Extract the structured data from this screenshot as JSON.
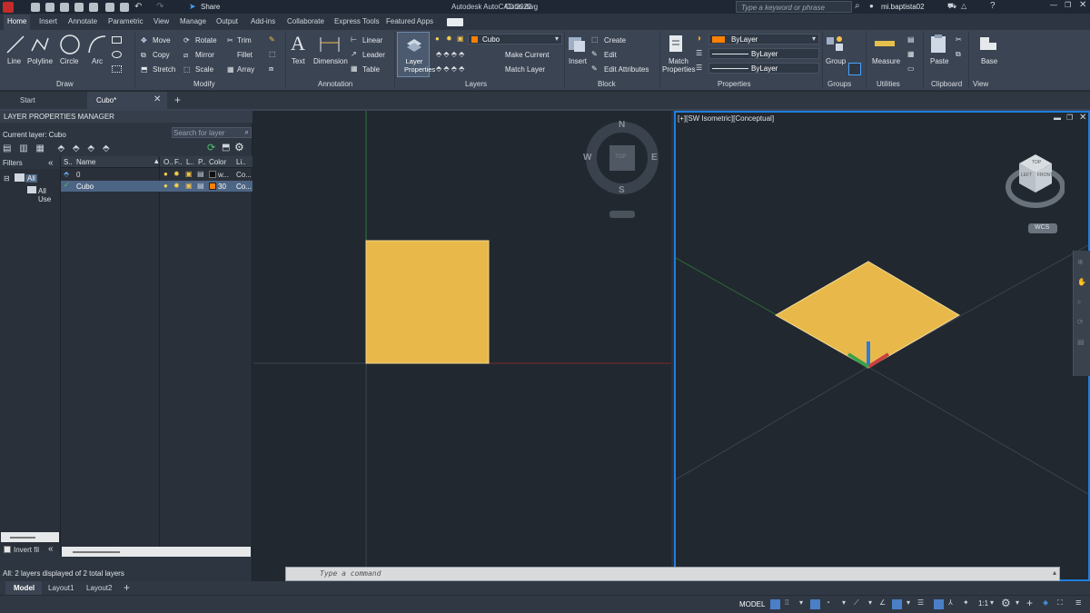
{
  "app": {
    "title": "Autodesk AutoCAD 2022",
    "file": "Cubo.dwg",
    "share_label": "Share",
    "search_placeholder": "Type a keyword or phrase",
    "user": "mi.baptista02"
  },
  "ribbon_tabs": [
    "Home",
    "Insert",
    "Annotate",
    "Parametric",
    "View",
    "Manage",
    "Output",
    "Add-ins",
    "Collaborate",
    "Express Tools",
    "Featured Apps"
  ],
  "panels": {
    "draw": {
      "title": "Draw",
      "items": [
        "Line",
        "Polyline",
        "Circle",
        "Arc"
      ]
    },
    "modify": {
      "title": "Modify",
      "items": [
        "Move",
        "Rotate",
        "Trim",
        "Copy",
        "Mirror",
        "Fillet",
        "Stretch",
        "Scale",
        "Array"
      ]
    },
    "annotation": {
      "title": "Annotation",
      "items": [
        "Text",
        "Dimension",
        "Linear",
        "Leader",
        "Table"
      ]
    },
    "layers": {
      "title": "Layers",
      "layer_props": "Layer Properties",
      "current": "Cubo",
      "make_current": "Make Current",
      "match_layer": "Match Layer"
    },
    "block": {
      "title": "Block",
      "items": [
        "Insert",
        "Create",
        "Edit",
        "Edit Attributes"
      ]
    },
    "properties": {
      "title": "Properties",
      "match": "Match Properties",
      "color": "ByLayer",
      "linetype": "ByLayer",
      "lineweight": "ByLayer"
    },
    "groups": {
      "title": "Groups",
      "item": "Group"
    },
    "utilities": {
      "title": "Utilities",
      "item": "Measure"
    },
    "clipboard": {
      "title": "Clipboard",
      "item": "Paste"
    },
    "view": {
      "title": "View",
      "item": "Base"
    }
  },
  "doc_tabs": [
    "Start",
    "Cubo*"
  ],
  "layer_manager": {
    "title": "LAYER PROPERTIES MANAGER",
    "current_layer": "Current layer: Cubo",
    "search_placeholder": "Search for layer",
    "filters_label": "Filters",
    "tree": [
      "All",
      "All Use"
    ],
    "columns": [
      "S..",
      "Name",
      "O..",
      "F..",
      "L..",
      "P..",
      "Color",
      "Li.."
    ],
    "layers": [
      {
        "name": "0",
        "color_label": "w...",
        "color_hex": "#ffffff",
        "linetype": "Co..."
      },
      {
        "name": "Cubo",
        "color_label": "30",
        "color_hex": "#ff7f00",
        "linetype": "Co..."
      }
    ],
    "invert_filter": "Invert fil",
    "status": "All: 2 layers displayed of 2 total layers"
  },
  "viewport_right": {
    "label": "[+][SW Isometric][Conceptual]",
    "cube_top": "TOP",
    "cube_left": "LEFT",
    "cube_front": "FRONT",
    "wcs": "WCS"
  },
  "viewport_left": {
    "compass": {
      "n": "N",
      "s": "S",
      "e": "E",
      "w": "W",
      "top": "TOP"
    }
  },
  "command": {
    "placeholder": "Type a command"
  },
  "layout_tabs": [
    "Model",
    "Layout1",
    "Layout2"
  ],
  "status": {
    "model": "MODEL",
    "scale": "1:1"
  },
  "colors": {
    "accent": "#1f7ee0",
    "object_fill": "#e8b94a",
    "ribbon": "#3b4453"
  }
}
